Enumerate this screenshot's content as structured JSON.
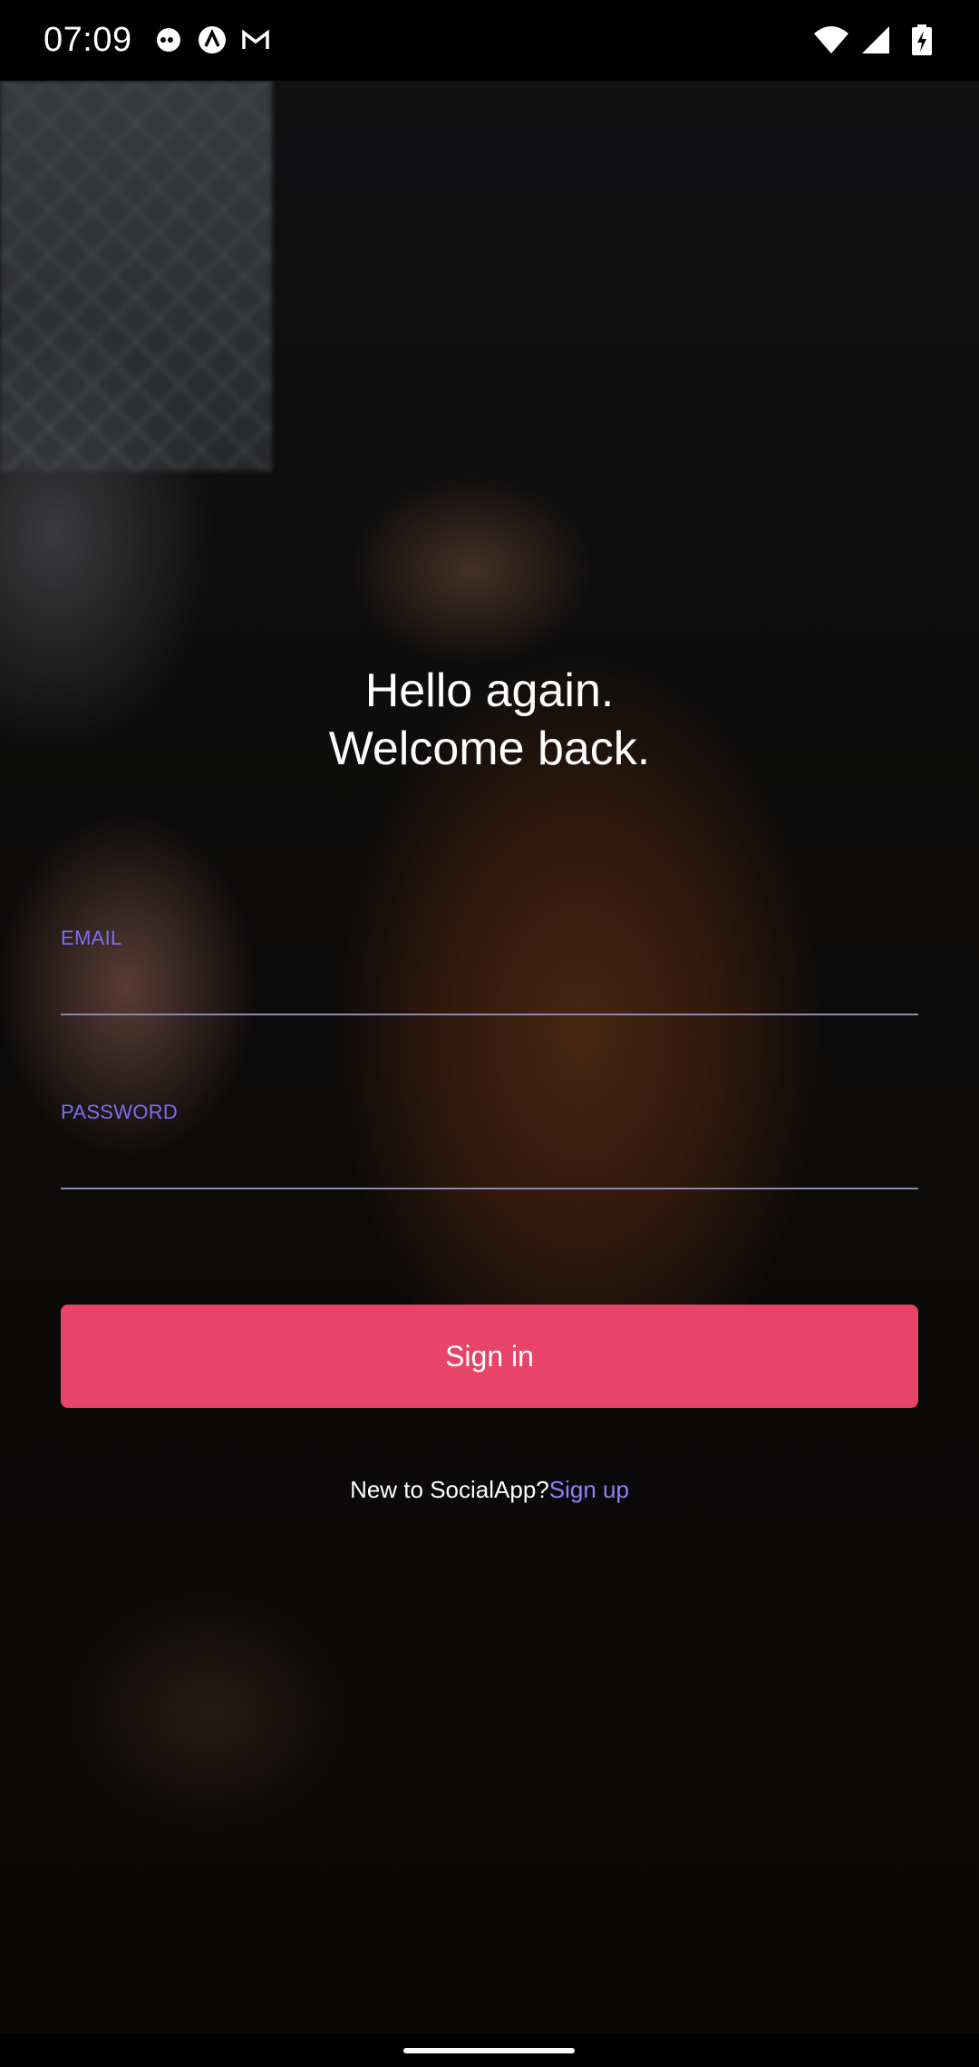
{
  "status_bar": {
    "time": "07:09",
    "icons": [
      "jio-icon",
      "app-circle-icon",
      "gmail-icon",
      "wifi-icon",
      "signal-icon",
      "battery-charging-icon"
    ]
  },
  "login": {
    "heading_line1": "Hello again.",
    "heading_line2": "Welcome back.",
    "email_label": "EMAIL",
    "email_value": "",
    "password_label": "PASSWORD",
    "password_value": "",
    "signin_label": "Sign in",
    "signup_prompt": "New to SocialApp?",
    "signup_link": "Sign up"
  },
  "colors": {
    "accent": "#e8446a",
    "label": "#7a6ff0",
    "link": "#8f82ff"
  }
}
